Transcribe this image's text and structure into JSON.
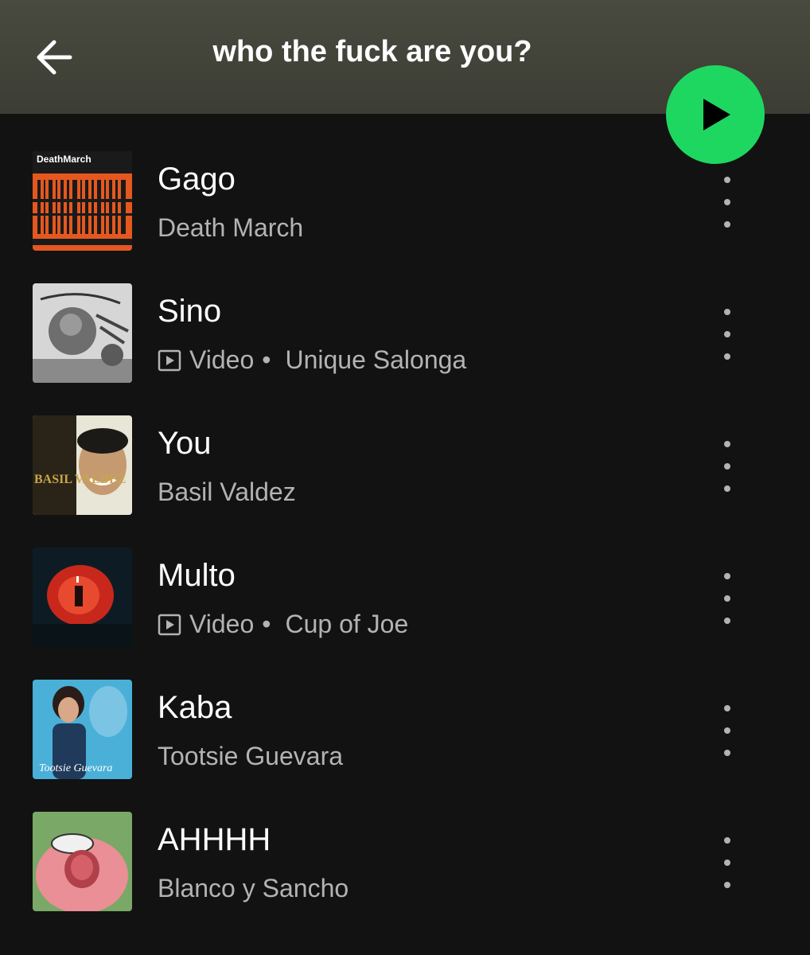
{
  "header": {
    "back_icon": "arrow-left-icon",
    "title": "who the fuck are you?"
  },
  "play_button": {
    "icon": "play-icon",
    "color": "#1ed760"
  },
  "tracks": [
    {
      "title": "Gago",
      "video": false,
      "video_label": "",
      "artist": "Death March",
      "art_text": "DeathMarch"
    },
    {
      "title": "Sino",
      "video": true,
      "video_label": "Video",
      "artist": "Unique Salonga",
      "art_text": ""
    },
    {
      "title": "You",
      "video": false,
      "video_label": "",
      "artist": "Basil Valdez",
      "art_text": "BASIL VALDEZ"
    },
    {
      "title": "Multo",
      "video": true,
      "video_label": "Video",
      "artist": "Cup of Joe",
      "art_text": ""
    },
    {
      "title": "Kaba",
      "video": false,
      "video_label": "",
      "artist": "Tootsie Guevara",
      "art_text": "Tootsie Guevara"
    },
    {
      "title": "AHHHH",
      "video": false,
      "video_label": "",
      "artist": "Blanco y Sancho",
      "art_text": ""
    }
  ],
  "separator": "•",
  "colors": {
    "background": "#121212",
    "header": "#494a3f",
    "accent": "#1ed760",
    "primary_text": "#ffffff",
    "secondary_text": "#b3b3b3"
  }
}
